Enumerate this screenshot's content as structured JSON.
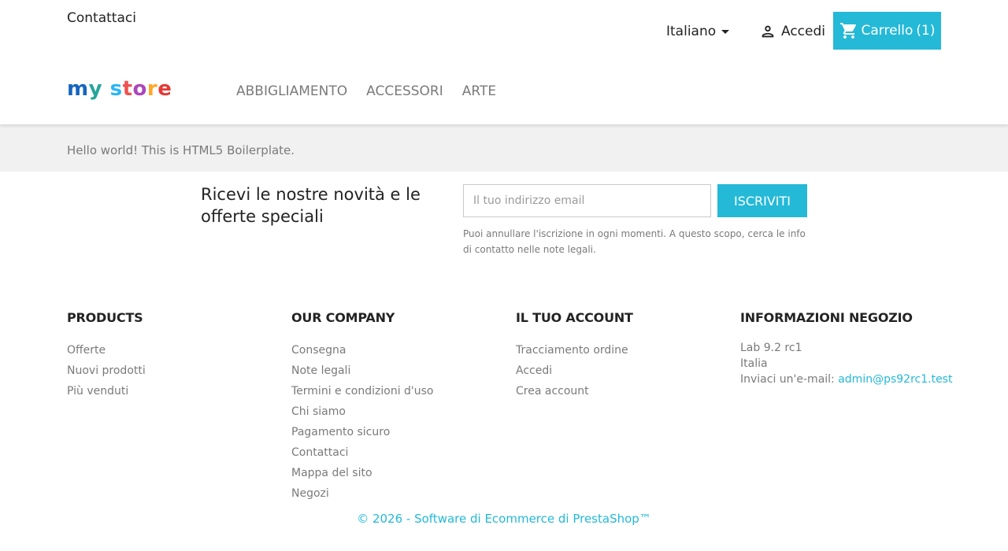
{
  "header": {
    "contact_label": "Contattaci",
    "language_label": "Italiano",
    "signin_label": "Accedi",
    "cart_label": "Carrello",
    "cart_count": "(1)",
    "logo_parts": [
      {
        "text": "m",
        "color": "#1565c0"
      },
      {
        "text": "y",
        "color": "#26a69a"
      },
      {
        "text": " ",
        "color": "#ffffff"
      },
      {
        "text": "s",
        "color": "#29b6f6"
      },
      {
        "text": "t",
        "color": "#ef5350"
      },
      {
        "text": "o",
        "color": "#ab47bc"
      },
      {
        "text": "r",
        "color": "#ffa726"
      },
      {
        "text": "e",
        "color": "#e53935"
      }
    ],
    "nav": [
      "ABBIGLIAMENTO",
      "ACCESSORI",
      "ARTE"
    ]
  },
  "hello_text": "Hello world! This is HTML5 Boilerplate.",
  "newsletter": {
    "title": "Ricevi le nostre novità e le offerte speciali",
    "email_placeholder": "Il tuo indirizzo email",
    "button_label": "ISCRIVITI",
    "note": "Puoi annullare l'iscrizione in ogni momenti. A questo scopo, cerca le info di contatto nelle note legali."
  },
  "footer": {
    "products": {
      "title": "PRODUCTS",
      "items": [
        "Offerte",
        "Nuovi prodotti",
        "Più venduti"
      ]
    },
    "company": {
      "title": "OUR COMPANY",
      "items": [
        "Consegna",
        "Note legali",
        "Termini e condizioni d'uso",
        "Chi siamo",
        "Pagamento sicuro",
        "Contattaci",
        "Mappa del sito",
        "Negozi"
      ]
    },
    "account": {
      "title": "IL TUO ACCOUNT",
      "items": [
        "Tracciamento ordine",
        "Accedi",
        "Crea account"
      ]
    },
    "store": {
      "title": "INFORMAZIONI NEGOZIO",
      "line1": "Lab 9.2 rc1",
      "line2": "Italia",
      "email_prefix": "Inviaci un'e-mail:",
      "email": "admin@ps92rc1.test"
    },
    "copyright": "© 2026 - Software di Ecommerce di PrestaShop™"
  },
  "colors": {
    "accent": "#24b9d7",
    "text": "#232323",
    "muted": "#7a7a7a"
  },
  "icons": {
    "signin": "person-icon",
    "cart": "shopping-cart-icon",
    "language": "caret-down-icon"
  }
}
